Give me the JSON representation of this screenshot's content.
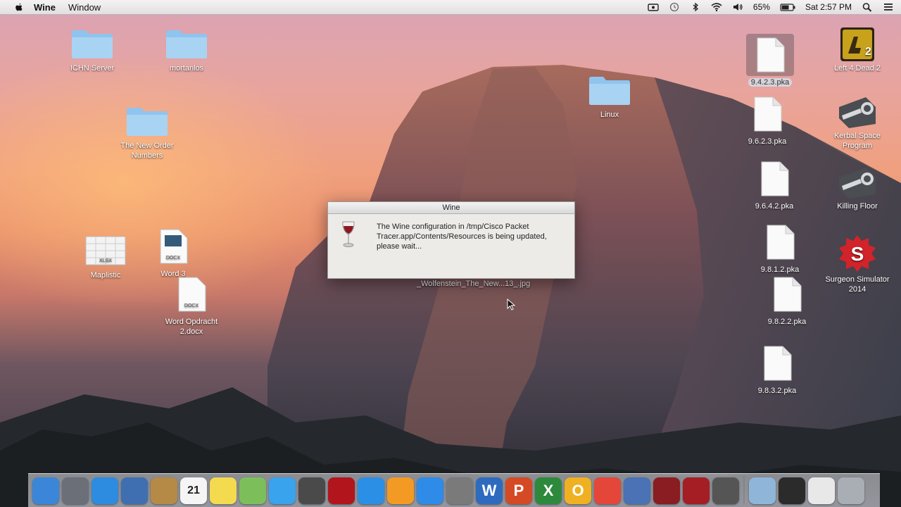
{
  "menubar": {
    "app_name": "Wine",
    "menus": [
      "Window"
    ],
    "battery": "65%",
    "clock": "Sat 2:57 PM"
  },
  "desktop_icons_left": [
    {
      "name": "ICHN Server",
      "kind": "folder"
    },
    {
      "name": "mortanlos",
      "kind": "folder"
    },
    {
      "name": "The New Order Numbers",
      "kind": "folder"
    },
    {
      "name": "Maplistic",
      "kind": "xlsx",
      "badge": "XLSX"
    },
    {
      "name": "Word 3",
      "kind": "docx",
      "badge": "DOCX"
    },
    {
      "name": "Word Opdracht 2.docx",
      "kind": "docx",
      "badge": "DOCX"
    }
  ],
  "desktop_icons_mid": [
    {
      "name": "Linux",
      "kind": "folder"
    }
  ],
  "desktop_icons_files": [
    {
      "name": "9.4.2.3.pka",
      "selected": true
    },
    {
      "name": "9.6.2.3.pka"
    },
    {
      "name": "9.6.4.2.pka"
    },
    {
      "name": "9.8.1.2.pka"
    },
    {
      "name": "9.8.2.2.pka"
    },
    {
      "name": "9.8.3.2.pka"
    }
  ],
  "desktop_icons_right": [
    {
      "name": "Left 4 Dead 2",
      "kind": "game",
      "color": "#c8a21c"
    },
    {
      "name": "Kerbal Space Program",
      "kind": "steam"
    },
    {
      "name": "Killing Floor",
      "kind": "steam"
    },
    {
      "name": "Surgeon Simulator 2014",
      "kind": "game",
      "color": "#d2232a"
    }
  ],
  "behind_dialog_label": "_Wolfenstein_The_New...13_.jpg",
  "dialog": {
    "title": "Wine",
    "message": "The Wine configuration in /tmp/Cisco Packet Tracer.app/Contents/Resources is being updated, please wait..."
  },
  "dock": [
    {
      "name": "finder",
      "color": "#3b86d9",
      "glyph": ""
    },
    {
      "name": "launchpad",
      "color": "#6a6f78",
      "glyph": ""
    },
    {
      "name": "safari",
      "color": "#2d8be0",
      "glyph": ""
    },
    {
      "name": "preview",
      "color": "#3f6fb0",
      "glyph": ""
    },
    {
      "name": "contacts",
      "color": "#b58a47",
      "glyph": ""
    },
    {
      "name": "calendar",
      "color": "#f5f5f5",
      "glyph": "21"
    },
    {
      "name": "notes",
      "color": "#f3da4f",
      "glyph": ""
    },
    {
      "name": "maps",
      "color": "#7cbf5a",
      "glyph": ""
    },
    {
      "name": "messages",
      "color": "#3aa3ee",
      "glyph": ""
    },
    {
      "name": "facetime",
      "color": "#4a4a4a",
      "glyph": ""
    },
    {
      "name": "photo-booth",
      "color": "#b3151d",
      "glyph": ""
    },
    {
      "name": "itunes",
      "color": "#2c8fe6",
      "glyph": ""
    },
    {
      "name": "ibooks",
      "color": "#f39a24",
      "glyph": ""
    },
    {
      "name": "app-store",
      "color": "#2f8be8",
      "glyph": ""
    },
    {
      "name": "image-capture",
      "color": "#7a7a7a",
      "glyph": ""
    },
    {
      "name": "word",
      "color": "#2e6bbf",
      "glyph": "W"
    },
    {
      "name": "powerpoint",
      "color": "#d54a25",
      "glyph": "P"
    },
    {
      "name": "excel",
      "color": "#2d8a3d",
      "glyph": "X"
    },
    {
      "name": "outlook",
      "color": "#efb122",
      "glyph": "O"
    },
    {
      "name": "chrome",
      "color": "#e4463a",
      "glyph": ""
    },
    {
      "name": "stickies",
      "color": "#4a72b5",
      "glyph": ""
    },
    {
      "name": "wine-app-1",
      "color": "#8a1d22",
      "glyph": ""
    },
    {
      "name": "wine-app-2",
      "color": "#a51e23",
      "glyph": ""
    },
    {
      "name": "terminal",
      "color": "#555555",
      "glyph": ""
    },
    {
      "name": "downloads-folder",
      "color": "#8fb6d9",
      "glyph": ""
    },
    {
      "name": "activity-monitor",
      "color": "#2b2b2b",
      "glyph": ""
    },
    {
      "name": "document-stack",
      "color": "#e8e8e8",
      "glyph": ""
    },
    {
      "name": "trash",
      "color": "#a8aeb3",
      "glyph": ""
    }
  ]
}
